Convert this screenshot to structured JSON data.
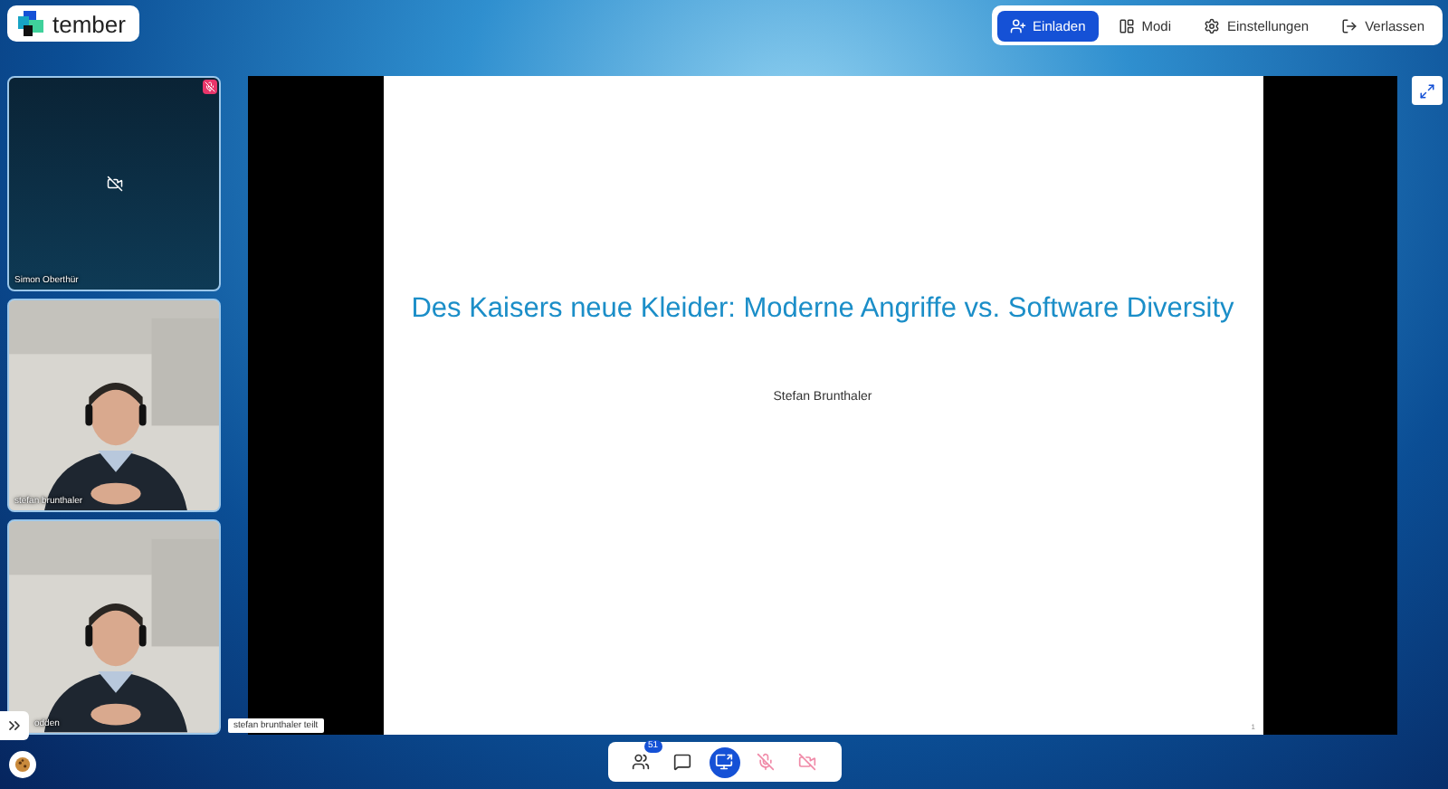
{
  "brand": {
    "name": "tember"
  },
  "menu": [
    {
      "label": "Einladen",
      "kind": "invite",
      "selected": true
    },
    {
      "label": "Modi",
      "kind": "modes",
      "selected": false
    },
    {
      "label": "Einstellungen",
      "kind": "settings",
      "selected": false
    },
    {
      "label": "Verlassen",
      "kind": "leave",
      "selected": false
    }
  ],
  "participants": [
    {
      "name": "Simon Oberthür",
      "kind": "camera-off",
      "muted": true
    },
    {
      "name": "stefan brunthaler",
      "kind": "video",
      "muted": false
    },
    {
      "name": "odden",
      "kind": "video",
      "muted": false
    }
  ],
  "slide": {
    "title": "Des Kaisers neue Kleider: Moderne Angriffe vs. Software Diversity",
    "author": "Stefan Brunthaler",
    "page": "1"
  },
  "share_notice": "stefan brunthaler teilt",
  "toolbar": [
    {
      "kind": "participants",
      "badge": "51"
    },
    {
      "kind": "chat"
    },
    {
      "kind": "screen",
      "active": true
    },
    {
      "kind": "mic",
      "active": false
    },
    {
      "kind": "camera",
      "active": false
    }
  ]
}
